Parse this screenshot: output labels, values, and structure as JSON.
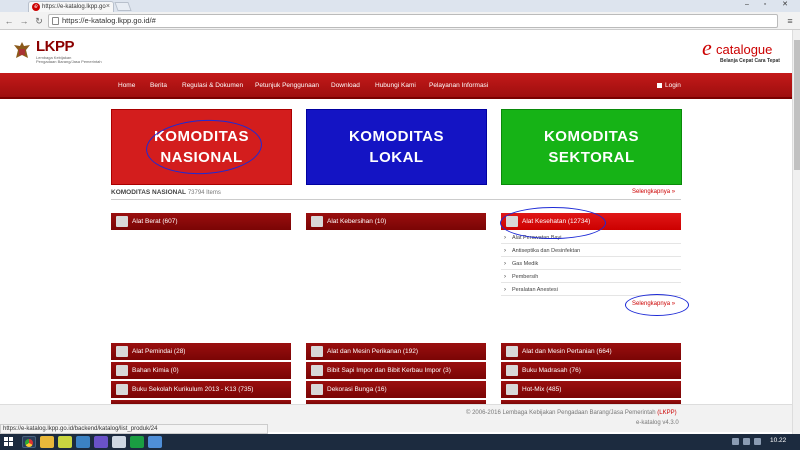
{
  "browser": {
    "tab_title": "https://e-katalog.lkpp.go",
    "url": "https://e-katalog.lkpp.go.id/#",
    "status_url": "https://e-katalog.lkpp.go.id/backend/katalog/list_produk/24"
  },
  "header": {
    "logo_text": "LKPP",
    "logo_sub1": "Lembaga Kebijakan",
    "logo_sub2": "Pengadaan Barang/Jasa Pemerintah",
    "ecatalogue_e": "e",
    "ecatalogue_text": "catalogue",
    "ecatalogue_tagline": "Belanja Cepat Cara Tepat"
  },
  "nav": {
    "items": [
      "Home",
      "Berita",
      "Regulasi & Dokumen",
      "Petunjuk Penggunaan",
      "Download",
      "Hubungi Kami",
      "Pelayanan Informasi"
    ],
    "login": "Login"
  },
  "categories": [
    {
      "line1": "KOMODITAS",
      "line2": "NASIONAL",
      "color": "#d31d1d"
    },
    {
      "line1": "KOMODITAS",
      "line2": "LOKAL",
      "color": "#1414c4"
    },
    {
      "line1": "KOMODITAS",
      "line2": "SEKTORAL",
      "color": "#16b316"
    }
  ],
  "komoditas": {
    "title": "KOMODITAS NASIONAL",
    "count": "73794 Items",
    "more": "Selengkapnya  »"
  },
  "top_bars": [
    {
      "label": "Alat Berat (607)"
    },
    {
      "label": "Alat Kebersihan (10)"
    },
    {
      "label": "Alat Kesehatan (12734)"
    }
  ],
  "alat_kesehatan_sub": [
    "Alat Perawatan Bayi",
    "Antiseptika dan Desinfektan",
    "Gas Medik",
    "Pembersih",
    "Peralatan Anestesi"
  ],
  "sub_more": "Selengkapnya  »",
  "grid_bars": [
    [
      "Alat Pemindai (28)",
      "Alat dan Mesin Perikanan (192)",
      "Alat dan Mesin Pertanian (664)"
    ],
    [
      "Bahan Kimia (0)",
      "Bibit Sapi Impor dan Bibit Kerbau Impor (3)",
      "Buku Madrasah (76)"
    ],
    [
      "Buku Sekolah Kurikulum 2013 - K13 (735)",
      "Dekorasi Bunga (16)",
      "Hot-Mix (485)"
    ]
  ],
  "footer": {
    "copy": "© 2006-2016 Lembaga Kebijakan Pengadaan Barang/Jasa Pemerintah",
    "copy_link": "(LKPP)",
    "version": "e-katalog v4.3.0"
  },
  "taskbar": {
    "clock": "10.22"
  },
  "colors": {
    "brand_red": "#c41a1a",
    "dark_red": "#7a0505",
    "annotation_blue": "#1d2ad6"
  }
}
